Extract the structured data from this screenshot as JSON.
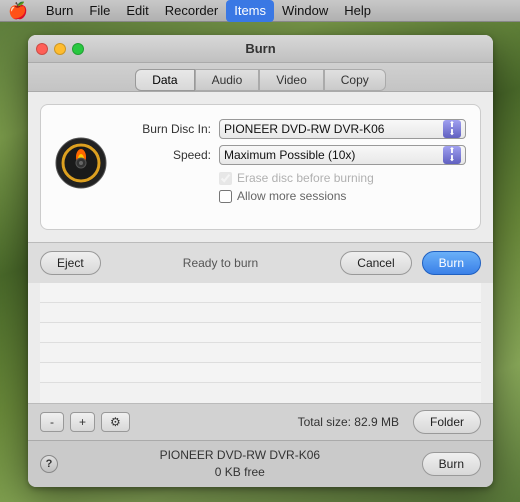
{
  "menubar": {
    "apple": "🍎",
    "items": [
      "Burn",
      "File",
      "Edit",
      "Recorder",
      "Items",
      "Window",
      "Help"
    ],
    "active": "Items"
  },
  "window": {
    "title": "Burn",
    "tabs": [
      {
        "id": "data",
        "label": "Data",
        "active": true
      },
      {
        "id": "audio",
        "label": "Audio",
        "active": false
      },
      {
        "id": "video",
        "label": "Video",
        "active": false
      },
      {
        "id": "copy",
        "label": "Copy",
        "active": false
      }
    ]
  },
  "dialog": {
    "burn_disc_label": "Burn Disc In:",
    "burn_disc_value": "PIONEER DVD-RW DVR-K06",
    "speed_label": "Speed:",
    "speed_value": "Maximum Possible (10x)",
    "erase_label": "Erase disc before burning",
    "sessions_label": "Allow more sessions"
  },
  "action_bar": {
    "eject_label": "Eject",
    "status": "Ready to burn",
    "cancel_label": "Cancel",
    "burn_label": "Burn"
  },
  "bottom_toolbar": {
    "minus_label": "-",
    "plus_label": "+",
    "gear_label": "⚙",
    "total_size_label": "Total size: 82.9 MB",
    "folder_label": "Folder"
  },
  "statusbar": {
    "help_label": "?",
    "device_name": "PIONEER DVD-RW DVR-K06",
    "device_space": "0 KB free",
    "burn_label": "Burn"
  }
}
